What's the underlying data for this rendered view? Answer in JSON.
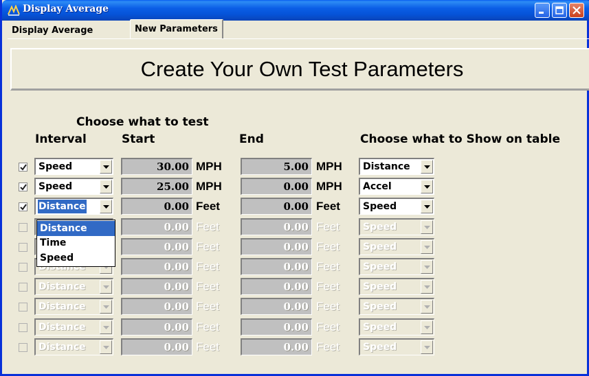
{
  "window": {
    "title": "Display Average"
  },
  "tabs": [
    {
      "label": "Display Average",
      "active": false
    },
    {
      "label": "New Parameters",
      "active": true
    }
  ],
  "banner": {
    "text": "Create Your Own Test Parameters"
  },
  "headers": {
    "choose": "Choose what to test",
    "interval": "Interval",
    "start": "Start",
    "end": "End",
    "show": "Choose what to Show on table"
  },
  "rows": [
    {
      "checked": true,
      "enabled": true,
      "interval": "Speed",
      "start": "30.00",
      "start_unit": "MPH",
      "end": "5.00",
      "end_unit": "MPH",
      "show": "Distance"
    },
    {
      "checked": true,
      "enabled": true,
      "interval": "Speed",
      "start": "25.00",
      "start_unit": "MPH",
      "end": "0.00",
      "end_unit": "MPH",
      "show": "Accel"
    },
    {
      "checked": true,
      "enabled": true,
      "interval": "Distance",
      "start": "0.00",
      "start_unit": "Feet",
      "end": "0.00",
      "end_unit": "Feet",
      "show": "Speed"
    },
    {
      "checked": false,
      "enabled": false,
      "interval": "Distance",
      "start": "0.00",
      "start_unit": "Feet",
      "end": "0.00",
      "end_unit": "Feet",
      "show": "Speed"
    },
    {
      "checked": false,
      "enabled": false,
      "interval": "Distance",
      "start": "0.00",
      "start_unit": "Feet",
      "end": "0.00",
      "end_unit": "Feet",
      "show": "Speed"
    },
    {
      "checked": false,
      "enabled": false,
      "interval": "Distance",
      "start": "0.00",
      "start_unit": "Feet",
      "end": "0.00",
      "end_unit": "Feet",
      "show": "Speed"
    },
    {
      "checked": false,
      "enabled": false,
      "interval": "Distance",
      "start": "0.00",
      "start_unit": "Feet",
      "end": "0.00",
      "end_unit": "Feet",
      "show": "Speed"
    },
    {
      "checked": false,
      "enabled": false,
      "interval": "Distance",
      "start": "0.00",
      "start_unit": "Feet",
      "end": "0.00",
      "end_unit": "Feet",
      "show": "Speed"
    },
    {
      "checked": false,
      "enabled": false,
      "interval": "Distance",
      "start": "0.00",
      "start_unit": "Feet",
      "end": "0.00",
      "end_unit": "Feet",
      "show": "Speed"
    },
    {
      "checked": false,
      "enabled": false,
      "interval": "Distance",
      "start": "0.00",
      "start_unit": "Feet",
      "end": "0.00",
      "end_unit": "Feet",
      "show": "Speed"
    }
  ],
  "dropdown": {
    "options": [
      "Distance",
      "Time",
      "Speed"
    ],
    "selected": "Distance"
  },
  "icons": {
    "app": "app-icon",
    "minimize": "minimize-icon",
    "maximize": "maximize-icon",
    "close": "close-icon"
  }
}
